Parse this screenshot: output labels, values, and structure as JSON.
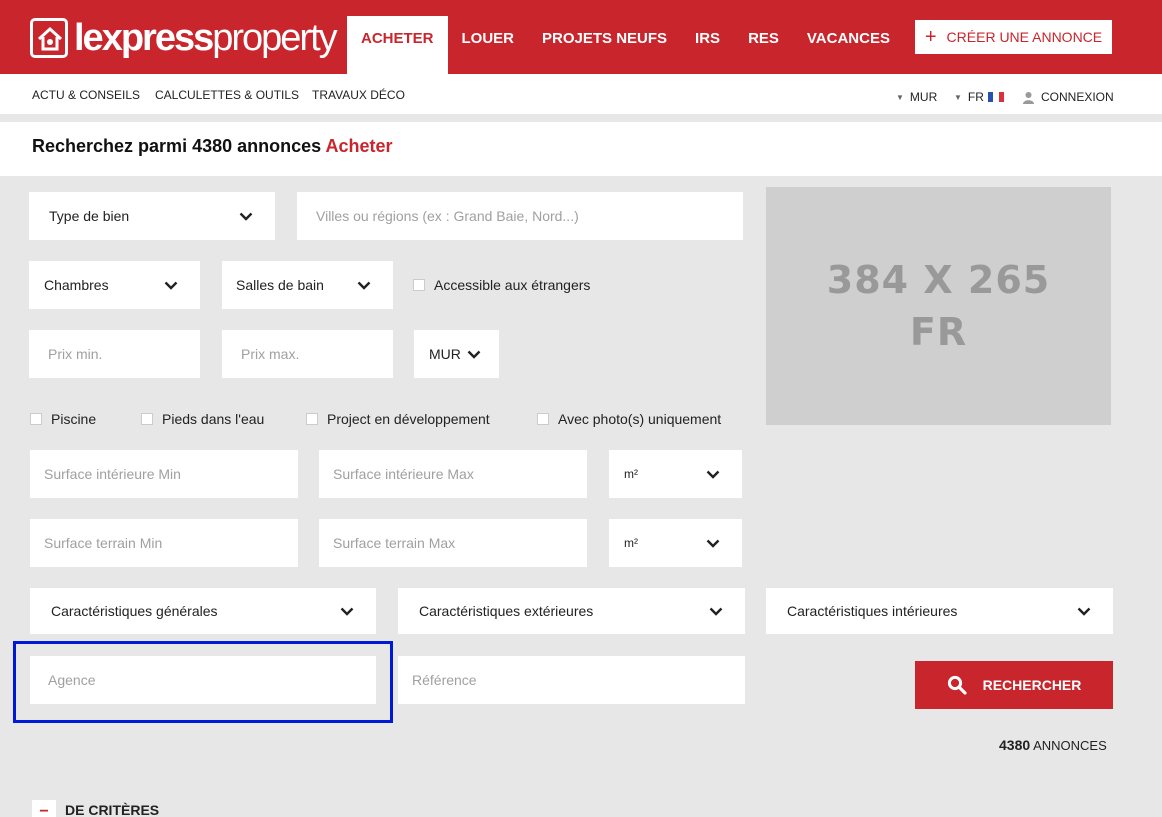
{
  "brand": {
    "logo_bold": "lexpress",
    "logo_light": "property",
    "accent": "#c8252c"
  },
  "nav": {
    "tabs": [
      "ACHETER",
      "LOUER",
      "PROJETS NEUFS",
      "IRS",
      "RES",
      "VACANCES"
    ],
    "active_tab": "ACHETER",
    "create_label": "CRÉER UNE ANNONCE"
  },
  "subnav": {
    "links": [
      "ACTU & CONSEILS",
      "CALCULETTES & OUTILS",
      "TRAVAUX DÉCO"
    ],
    "currency": "MUR",
    "language": "FR",
    "login": "CONNEXION"
  },
  "heading": {
    "prefix": "Recherchez parmi 4380 annonces",
    "mode": "Acheter"
  },
  "form": {
    "type_de_bien": "Type de bien",
    "villes_placeholder": "Villes ou régions (ex : Grand Baie, Nord...)",
    "chambres": "Chambres",
    "salles_de_bain": "Salles de bain",
    "accessible": "Accessible aux étrangers",
    "prix_min_placeholder": "Prix min.",
    "prix_max_placeholder": "Prix max.",
    "currency_select": "MUR",
    "piscine": "Piscine",
    "pieds_eau": "Pieds dans l'eau",
    "projet_dev": "Project en développement",
    "avec_photo": "Avec photo(s) uniquement",
    "surf_int_min_placeholder": "Surface intérieure Min",
    "surf_int_max_placeholder": "Surface intérieure Max",
    "unit_int": "m²",
    "surf_ter_min_placeholder": "Surface terrain Min",
    "surf_ter_max_placeholder": "Surface terrain Max",
    "unit_ter": "m²",
    "carac_generales": "Caractéristiques générales",
    "carac_exterieures": "Caractéristiques extérieures",
    "carac_interieures": "Caractéristiques intérieures",
    "agence_placeholder": "Agence",
    "reference_placeholder": "Référence",
    "search_label": "RECHERCHER"
  },
  "ad": {
    "line1": "384 X 265",
    "line2": "FR"
  },
  "results": {
    "count": "4380",
    "label": "ANNONCES"
  },
  "criteria": {
    "toggle": "−",
    "label": "DE CRITÈRES"
  }
}
